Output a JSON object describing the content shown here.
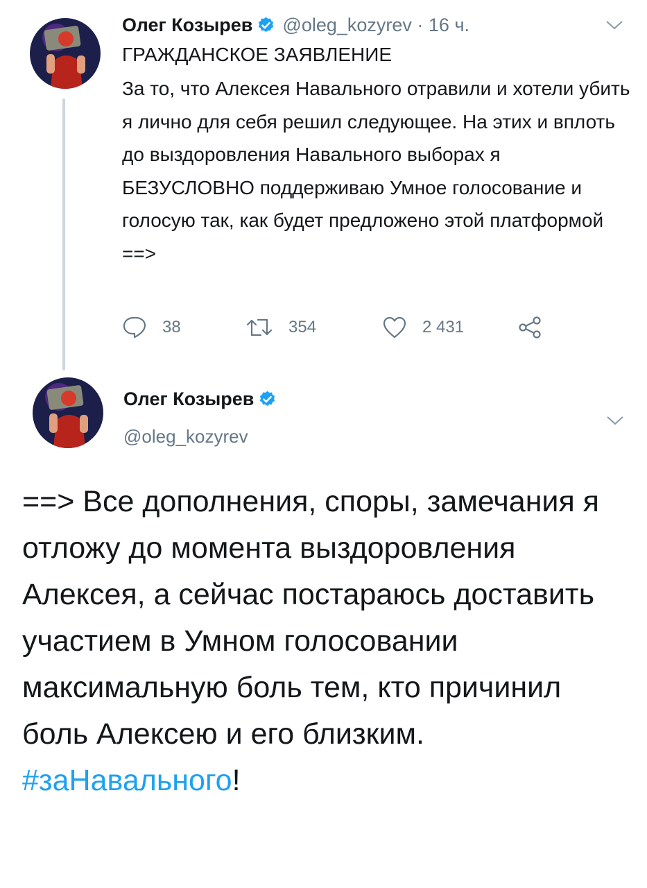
{
  "colors": {
    "text": "#14171a",
    "secondary": "#657786",
    "accent": "#1da1f2",
    "thread_line": "#ccd6dd"
  },
  "tweet1": {
    "author_name": "Олег Козырев",
    "handle": "@oleg_kozyrev",
    "time": "16 ч.",
    "meta": "@oleg_kozyrev · 16 ч.",
    "verified_icon": "verified-badge-icon",
    "title": "ГРАЖДАНСКОЕ ЗАЯВЛЕНИЕ",
    "body": "За то, что Алексея Навального отравили и хотели убить я лично для себя решил следующее. На этих и вплоть до выздоровления Навального выборах я БЕЗУСЛОВНО поддерживаю Умное голосование и голосую так, как будет предложено этой платформой ==>",
    "replies": "38",
    "retweets": "354",
    "likes": "2 431"
  },
  "tweet2": {
    "author_name": "Олег Козырев",
    "handle": "@oleg_kozyrev",
    "body": "==> Все дополнения, споры, замечания я отложу до момента выздоровления Алексея, а сейчас постараюсь доставить участием в Умном голосовании максимальную боль тем, кто причинил боль Алексею и его близким.",
    "hashtag": "#заНавального",
    "hashtag_suffix": "!"
  }
}
